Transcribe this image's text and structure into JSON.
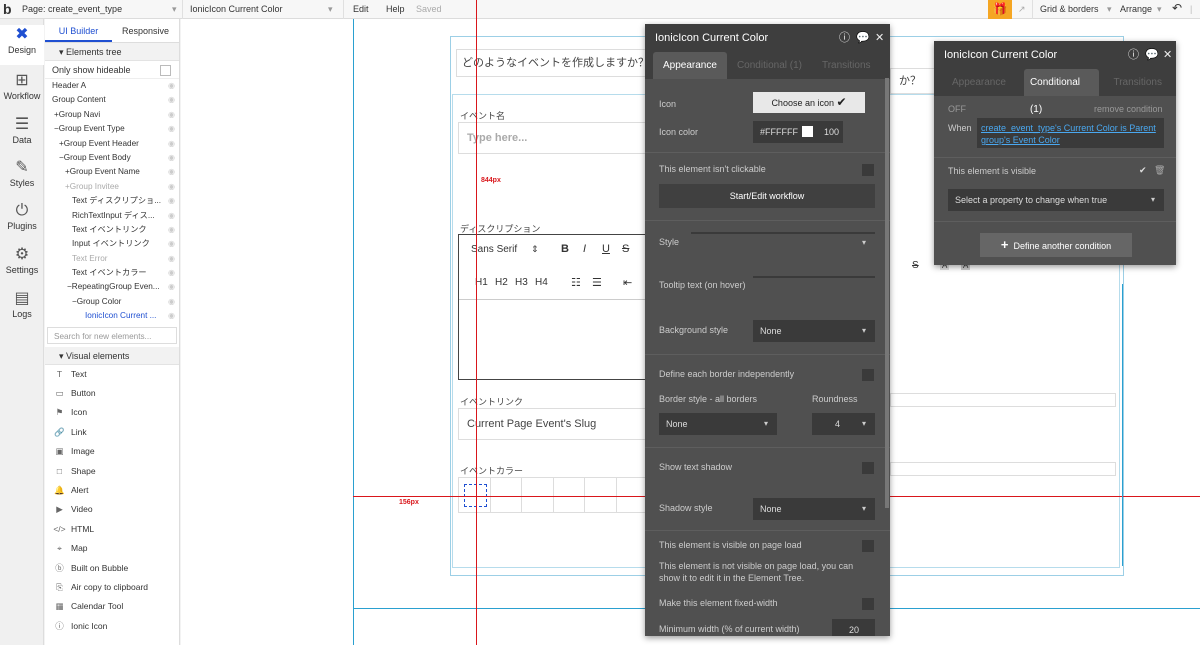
{
  "topbar": {
    "logo": "b",
    "page": "Page: create_event_type",
    "element": "IonicIcon Current Color",
    "menu": [
      "Edit",
      "Help"
    ],
    "saved": "Saved",
    "grid": "Grid & borders",
    "arrange": "Arrange",
    "undo_icon": "undo-icon"
  },
  "leftnav": [
    {
      "label": "Design",
      "icon": "design-icon"
    },
    {
      "label": "Workflow",
      "icon": "workflow-icon"
    },
    {
      "label": "Data",
      "icon": "data-icon"
    },
    {
      "label": "Styles",
      "icon": "styles-icon"
    },
    {
      "label": "Plugins",
      "icon": "plugins-icon"
    },
    {
      "label": "Settings",
      "icon": "settings-icon"
    },
    {
      "label": "Logs",
      "icon": "logs-icon"
    }
  ],
  "tree_tabs": {
    "ui": "UI Builder",
    "responsive": "Responsive"
  },
  "elements_tree": {
    "title": "Elements tree",
    "only_show": "Only show hideable",
    "items": [
      "Header A",
      "Group Content",
      "+Group Navi",
      "−Group Event Type",
      "+Group Event Header",
      "−Group Event Body",
      "+Group Event Name",
      "+Group Invitee",
      "Text ディスクリプショ...",
      "RichTextInput ディス...",
      "Text イベントリンク",
      "Input イベントリンク",
      "Text Error",
      "Text イベントカラー",
      "−RepeatingGroup Even...",
      "−Group Color",
      "IonicIcon Current ..."
    ],
    "search_placeholder": "Search for new elements..."
  },
  "visual_elements": {
    "title": "Visual elements",
    "items": [
      {
        "label": "Text",
        "glyph": "T"
      },
      {
        "label": "Button",
        "glyph": "▭"
      },
      {
        "label": "Icon",
        "glyph": "⚑"
      },
      {
        "label": "Link",
        "glyph": "🔗"
      },
      {
        "label": "Image",
        "glyph": "▣"
      },
      {
        "label": "Shape",
        "glyph": "□"
      },
      {
        "label": "Alert",
        "glyph": "🔔"
      },
      {
        "label": "Video",
        "glyph": "▶"
      },
      {
        "label": "HTML",
        "glyph": "</>"
      },
      {
        "label": "Map",
        "glyph": "⌖"
      },
      {
        "label": "Built on Bubble",
        "glyph": "ⓑ"
      },
      {
        "label": "Air copy to clipboard",
        "glyph": "⎘"
      },
      {
        "label": "Calendar Tool",
        "glyph": "▦"
      },
      {
        "label": "Ionic Icon",
        "glyph": "ⓘ"
      }
    ]
  },
  "canvas": {
    "question": "どのようなイベントを作成しますか？",
    "question2": "か？",
    "label_name": "イベント名",
    "name_placeholder": "Type here...",
    "label_desc": "ディスクリプション",
    "rte_font": "Sans Serif",
    "rte_buttons": [
      "B",
      "I",
      "U",
      "S"
    ],
    "rte_headers": [
      "H1",
      "H2",
      "H3",
      "H4"
    ],
    "label_link": "イベントリンク",
    "link_value": "Current Page Event's Slug",
    "label_color": "イベントカラー",
    "ruler1": "844px",
    "ruler2": "156px"
  },
  "panel1": {
    "title": "IonicIcon Current Color",
    "tabs": [
      "Appearance",
      "Conditional (1)",
      "Transitions"
    ],
    "icon_label": "Icon",
    "icon_button": "Choose an icon",
    "icon_color_label": "Icon color",
    "icon_color": "#FFFFFF",
    "icon_opacity": "100",
    "not_clickable": "This element isn't clickable",
    "workflow_btn": "Start/Edit workflow",
    "style_label": "Style",
    "tooltip_label": "Tooltip text (on hover)",
    "bg_label": "Background style",
    "bg_value": "None",
    "border_each": "Define each border independently",
    "border_all": "Border style - all borders",
    "roundness": "Roundness",
    "border_value": "None",
    "roundness_value": "4",
    "shadow_text": "Show text shadow",
    "shadow_style": "Shadow style",
    "shadow_value": "None",
    "visible_load": "This element is visible on page load",
    "visible_note": "This element is not visible on page load, you can show it to edit it in the Element Tree.",
    "fixed_width": "Make this element fixed-width",
    "min_width": "Minimum width (% of current width)",
    "min_width_value": "20"
  },
  "panel2": {
    "title": "IonicIcon Current Color",
    "tabs": [
      "Appearance",
      "Conditional (1)",
      "Transitions"
    ],
    "off": "OFF",
    "remove": "remove condition",
    "when": "When",
    "condition": "create_event_type's Current Color is Parent group's Event Color",
    "visible": "This element is visible",
    "select_prop": "Select a property to change when true",
    "define": "Define another condition"
  },
  "colors": {
    "accent": "#1f4fd1",
    "guide": "#2aa0d0",
    "ruler": "#d9161b",
    "gift": "#f5a623"
  }
}
